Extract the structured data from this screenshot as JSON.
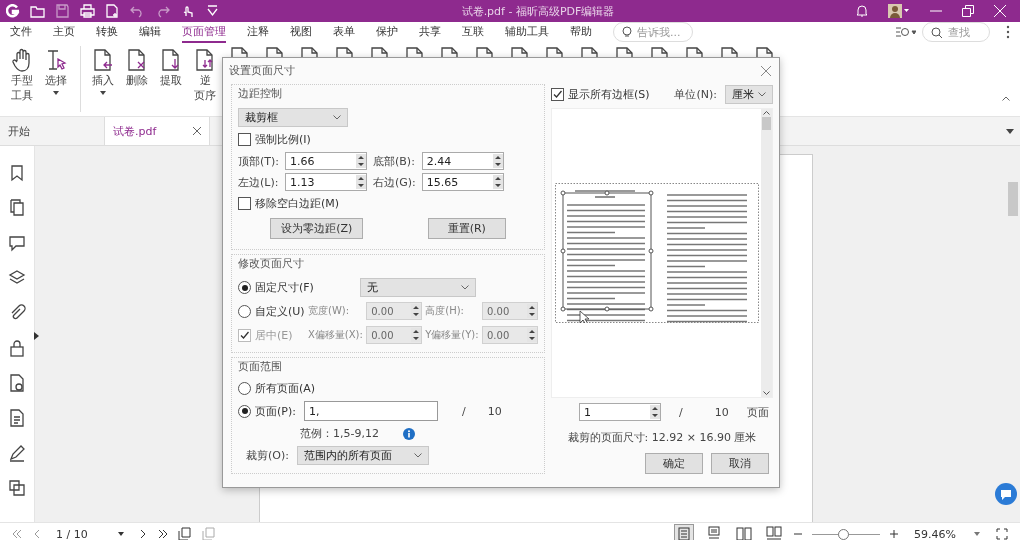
{
  "window": {
    "title": "试卷.pdf - 福昕高级PDF编辑器"
  },
  "menu_tabs": [
    {
      "label": "文件",
      "selected": false
    },
    {
      "label": "主页",
      "selected": false
    },
    {
      "label": "转换",
      "selected": false
    },
    {
      "label": "编辑",
      "selected": false
    },
    {
      "label": "页面管理",
      "selected": true
    },
    {
      "label": "注释",
      "selected": false
    },
    {
      "label": "视图",
      "selected": false
    },
    {
      "label": "表单",
      "selected": false
    },
    {
      "label": "保护",
      "selected": false
    },
    {
      "label": "共享",
      "selected": false
    },
    {
      "label": "互联",
      "selected": false
    },
    {
      "label": "辅助工具",
      "selected": false
    },
    {
      "label": "帮助",
      "selected": false
    }
  ],
  "tell_me": {
    "placeholder": "告诉我..."
  },
  "find": {
    "placeholder": "查找"
  },
  "ribbon": [
    {
      "kind": "hand",
      "lines": [
        "手型",
        "工具"
      ],
      "dropdown": false
    },
    {
      "kind": "select",
      "lines": [
        "选择"
      ],
      "dropdown": true
    },
    {
      "kind": "insert",
      "lines": [
        "插入"
      ],
      "dropdown": true
    },
    {
      "kind": "delete",
      "lines": [
        "删除"
      ],
      "dropdown": false
    },
    {
      "kind": "extract",
      "lines": [
        "提取"
      ],
      "dropdown": false
    },
    {
      "kind": "reverse",
      "lines": [
        "逆",
        "页序"
      ],
      "dropdown": false
    }
  ],
  "doc_tabs": [
    {
      "label": "开始",
      "selected": false,
      "closable": false
    },
    {
      "label": "试卷.pdf",
      "selected": true,
      "closable": true
    }
  ],
  "dialog": {
    "title": "设置页面尺寸",
    "margin_group": {
      "title": "边距控制",
      "box_type": "裁剪框",
      "constrain": {
        "label": "强制比例(I)",
        "checked": false
      },
      "fields": [
        {
          "label": "顶部(T):",
          "value": "1.66"
        },
        {
          "label": "底部(B):",
          "value": "2.44"
        },
        {
          "label": "左边(L):",
          "value": "1.13"
        },
        {
          "label": "右边(G):",
          "value": "15.65"
        }
      ],
      "remove_white": {
        "label": "移除空白边距(M)",
        "checked": false
      },
      "buttons": [
        "设为零边距(Z)",
        "重置(R)"
      ]
    },
    "size_group": {
      "title": "修改页面尺寸",
      "options": [
        {
          "label": "固定尺寸(F)",
          "selected": true
        },
        {
          "label": "自定义(U)",
          "selected": false
        }
      ],
      "fixed_size": "无",
      "custom_fields": [
        {
          "label": "宽度(W):",
          "value": "0.00",
          "disabled": true
        },
        {
          "label": "高度(H):",
          "value": "0.00",
          "disabled": true
        }
      ],
      "center": {
        "label": "居中(E)",
        "checked": true,
        "disabled": true
      },
      "offset_fields": [
        {
          "label": "X偏移量(X):",
          "value": "0.00",
          "disabled": true
        },
        {
          "label": "Y偏移量(Y):",
          "value": "0.00",
          "disabled": true
        }
      ]
    },
    "range_group": {
      "title": "页面范围",
      "options": [
        {
          "label": "所有页面(A)",
          "selected": false
        },
        {
          "label": "页面(P):",
          "selected": true
        }
      ],
      "pages_value": "1,",
      "slash": "/",
      "total": "10",
      "example": "范例：1,5-9,12",
      "crop_label": "裁剪(O):",
      "crop_value": "范围内的所有页面"
    },
    "show_all": {
      "label": "显示所有边框(S)",
      "checked": true
    },
    "unit_label": "单位(N):",
    "unit": "厘米",
    "page_spinner": "1",
    "page_slash": "/",
    "page_total": "10",
    "page_suffix": "页面",
    "cropped_size": "裁剪的页面尺寸: 12.92 × 16.90 厘米",
    "buttons": [
      "确定",
      "取消"
    ]
  },
  "status_bar": {
    "page_field": "1 / 10",
    "view_modes": [
      {
        "kind": "single",
        "selected": true
      },
      {
        "kind": "continuous",
        "selected": false
      },
      {
        "kind": "facing",
        "selected": false
      },
      {
        "kind": "facing-continuous",
        "selected": false
      }
    ],
    "zoom_slider": {
      "level": 0.45
    },
    "zoom": "59.46%"
  }
}
